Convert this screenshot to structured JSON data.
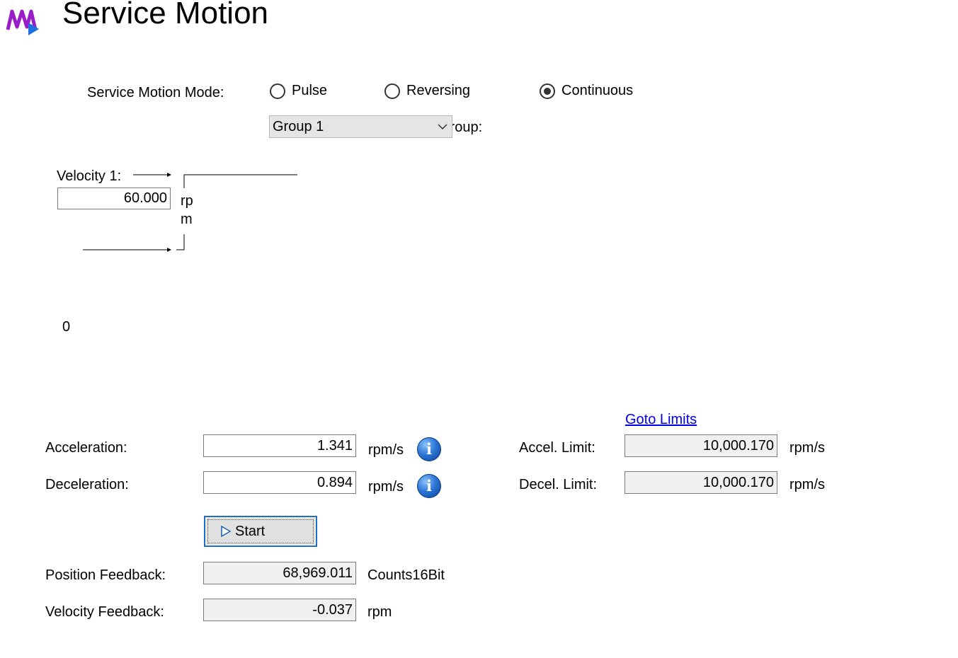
{
  "header": {
    "title": "Service Motion"
  },
  "mode": {
    "label": "Service Motion Mode:",
    "options": [
      {
        "label": "Pulse",
        "checked": false
      },
      {
        "label": "Reversing",
        "checked": false
      },
      {
        "label": "Continuous",
        "checked": true
      }
    ]
  },
  "group": {
    "selected": "Group 1",
    "label": "Group:"
  },
  "profile": {
    "velocity_label": "Velocity 1:",
    "velocity_value": "60.000",
    "velocity_unit_line1": "rp",
    "velocity_unit_line2": "m",
    "zero_label": "0"
  },
  "limits": {
    "goto_link": "Goto Limits",
    "accel_label": "Accel. Limit:",
    "accel_value": "10,000.170",
    "accel_unit": "rpm/s",
    "decel_label": "Decel. Limit:",
    "decel_value": "10,000.170",
    "decel_unit": "rpm/s"
  },
  "params": {
    "acceleration_label": "Acceleration:",
    "acceleration_value": "1.341",
    "acceleration_unit": "rpm/s",
    "deceleration_label": "Deceleration:",
    "deceleration_value": "0.894",
    "deceleration_unit": "rpm/s"
  },
  "actions": {
    "start_label": "Start"
  },
  "feedback": {
    "position_label": "Position Feedback:",
    "position_value": "68,969.011",
    "position_unit": "Counts16Bit",
    "velocity_label": "Velocity Feedback:",
    "velocity_value": "-0.037",
    "velocity_unit": "rpm"
  },
  "icons": {
    "app": "service-motion-logo",
    "info": "info-icon",
    "play": "play-icon",
    "dropdown": "chevron-down-icon"
  },
  "colors": {
    "logo_purple": "#9a1ec8",
    "logo_blue": "#1f6fe0",
    "link": "#0000ee",
    "focus_border": "#1c6fc8"
  }
}
